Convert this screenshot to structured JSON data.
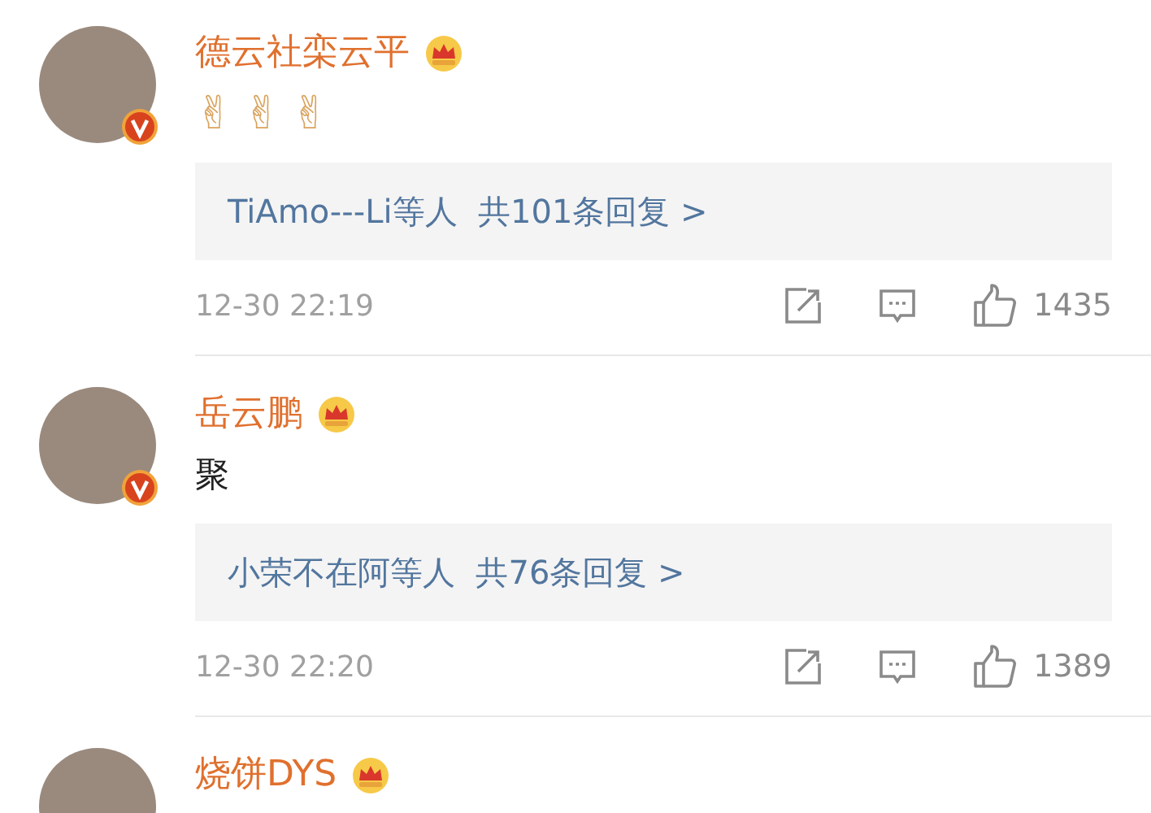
{
  "comments": [
    {
      "name": "德云社栾云平",
      "verified": true,
      "kind": "emoji",
      "body": "✌✌✌",
      "replies": "TiAmo---Li等人  共101条回复 >",
      "time": "12-30 22:19",
      "likes": "1435"
    },
    {
      "name": "岳云鹏",
      "verified": true,
      "kind": "text",
      "body": "聚",
      "replies": "小荣不在阿等人  共76条回复 >",
      "time": "12-30 22:20",
      "likes": "1389"
    },
    {
      "name": "烧饼DYS"
    }
  ]
}
